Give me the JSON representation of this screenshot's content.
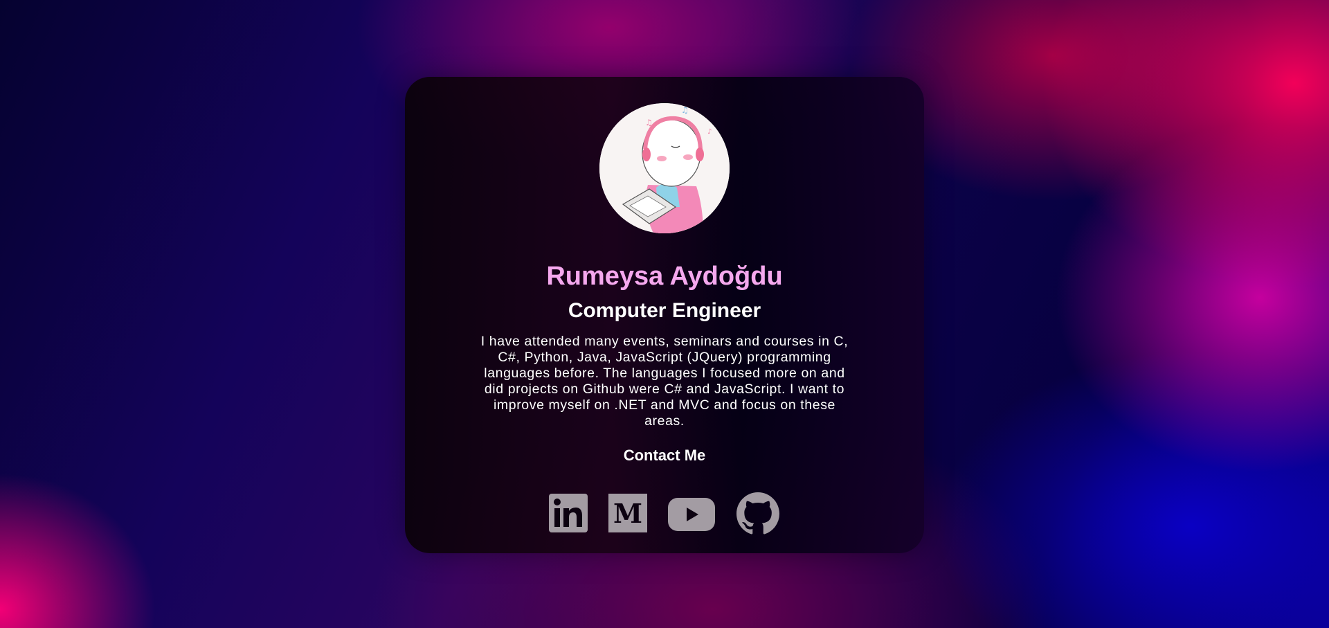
{
  "profile": {
    "name": "Rumeysa Aydoğdu",
    "title": "Computer Engineer",
    "bio": "I have attended many events, seminars and courses in C, C#, Python, Java, JavaScript (JQuery) programming languages before. The languages I focused more on and did projects on Github were C# and JavaScript. I want to improve myself on .NET and MVC and focus on these areas.",
    "avatar_icon": "avatar-illustration"
  },
  "contact": {
    "heading": "Contact Me"
  },
  "social": [
    {
      "icon": "linkedin-icon"
    },
    {
      "icon": "medium-icon"
    },
    {
      "icon": "youtube-icon"
    },
    {
      "icon": "github-icon"
    }
  ],
  "colors": {
    "name": "#f5a8ee",
    "text": "#ffffff",
    "icons": "#a39ca3",
    "card": "#0a0208"
  }
}
